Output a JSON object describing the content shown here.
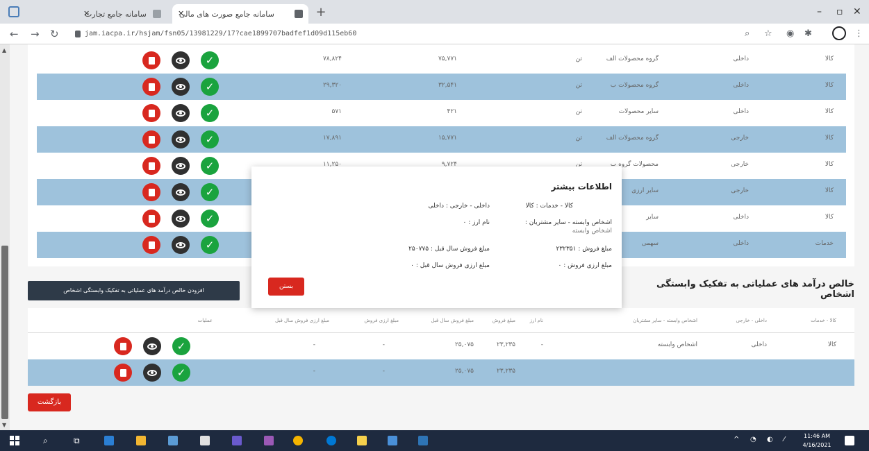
{
  "browser": {
    "tabs": [
      {
        "title": "سامانه جامع تجارت"
      },
      {
        "title": "سامانه جامع صورت های مالی"
      }
    ],
    "url": "jam.iacpa.ir/hsjam/fsn05/13981229/17?cae1899707badfef1d09d115eb60"
  },
  "table1": {
    "rows": [
      {
        "type": "کالا",
        "scope": "داخلی",
        "name": "گروه محصولات الف",
        "unit": "تن",
        "col_b": "۷۵,۷۷۱",
        "col_a": "۷۸,۸۲۴"
      },
      {
        "type": "کالا",
        "scope": "داخلی",
        "name": "گروه محصولات ب",
        "unit": "تن",
        "col_b": "۳۲,۵۴۱",
        "col_a": "۲۹,۳۲۰"
      },
      {
        "type": "کالا",
        "scope": "داخلی",
        "name": "سایر محصولات",
        "unit": "تن",
        "col_b": "۴۲۱",
        "col_a": "۵۷۱"
      },
      {
        "type": "کالا",
        "scope": "خارجی",
        "name": "گروه محصولات الف",
        "unit": "تن",
        "col_b": "۱۵,۷۷۱",
        "col_a": "۱۷,۸۹۱"
      },
      {
        "type": "کالا",
        "scope": "خارجی",
        "name": "محصولات گروه ب",
        "unit": "تن",
        "col_b": "۹,۷۲۴",
        "col_a": "۱۱,۲۵۰"
      },
      {
        "type": "کالا",
        "scope": "خارجی",
        "name": "سایر ارزی",
        "unit": "",
        "col_b": "",
        "col_a": ""
      },
      {
        "type": "کالا",
        "scope": "داخلی",
        "name": "سایر",
        "unit": "",
        "col_b": "",
        "col_a": ""
      },
      {
        "type": "خدمات",
        "scope": "داخلی",
        "name": "سهمی",
        "unit": "",
        "col_b": "",
        "col_a": ""
      }
    ]
  },
  "modal": {
    "title": "اطلاعات بیشتر",
    "goods_services": "کالا - خدمات : کالا",
    "domestic_foreign": "داخلی - خارجی : داخلی",
    "related_parties": "اشخاص وابسته - سایر مشتریان :",
    "related_parties_value": "اشخاص وابسته",
    "currency_name": "نام ارز : ۰",
    "sales_amount": "مبلغ فروش : ۲۳۲۳۵۱",
    "prev_year_sales": "مبلغ فروش سال قبل : ۲۵۰۷۷۵",
    "fx_sales": "مبلغ ارزی فروش : ۰",
    "prev_year_fx_sales": "مبلغ ارزی فروش سال قبل : ۰",
    "close_label": "بستن"
  },
  "section": {
    "title": "خالص درآمد های عملیاتی به تفکیک وابستگی اشخاص",
    "add_button": "افزودن خالص درآمد های عملیاتی به تفکیک وابستگی اشخاص"
  },
  "table2": {
    "headers": {
      "type": "کالا - خدمات",
      "scope": "داخلی - خارجی",
      "party": "اشخاص وابسته - سایر مشتریان",
      "currency": "نام ارز",
      "sales": "مبلغ فروش",
      "prev_sales": "مبلغ فروش سال قبل",
      "fx_sales": "مبلغ ارزی فروش",
      "prev_fx_sales": "مبلغ ارزی فروش سال قبل",
      "actions": "عملیات"
    },
    "rows": [
      {
        "type": "کالا",
        "scope": "داخلی",
        "party": "اشخاص وابسته",
        "currency": "-",
        "sales": "۲۳,۲۳۵",
        "prev_sales": "۲۵,۰۷۵",
        "fx_sales": "-",
        "prev_fx_sales": "-"
      },
      {
        "type": "",
        "scope": "",
        "party": "",
        "currency": "",
        "sales": "۲۳,۲۳۵",
        "prev_sales": "۲۵,۰۷۵",
        "fx_sales": "-",
        "prev_fx_sales": "-"
      }
    ]
  },
  "back_button": "بازگشت",
  "taskbar": {
    "time": "11:46 AM",
    "date": "4/16/2021"
  }
}
